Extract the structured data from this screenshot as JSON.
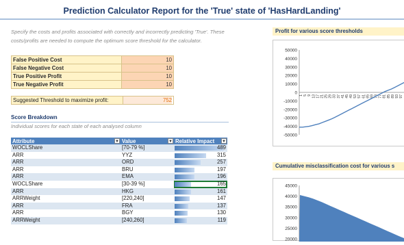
{
  "report": {
    "title": "Prediction Calculator Report for the 'True' state of 'HasHardLanding'",
    "note": "Specify the costs and profits associated with correctly and incorrectly predicting 'True'.  These costs/profits are needed to compute the optimum score threshold for the calculator."
  },
  "inputs": [
    {
      "label": "False Positive Cost",
      "value": "10"
    },
    {
      "label": "False Negative Cost",
      "value": "10"
    },
    {
      "label": "True Positive Profit",
      "value": "10"
    },
    {
      "label": "True Negative Profit",
      "value": "10"
    }
  ],
  "threshold": {
    "label": "Suggested Threshold to maximize profit:",
    "value": "752"
  },
  "score_breakdown": {
    "title": "Score Breakdown",
    "subtitle": "Individual scores for each state of each analysed column",
    "headers": {
      "attribute": "Attribute",
      "value": "Value",
      "impact": "Relative Impact"
    },
    "max_impact": 489,
    "rows": [
      {
        "attribute": "WOCLShare",
        "value": "[70-79 %]",
        "impact": 489
      },
      {
        "attribute": "ARR",
        "value": "YYZ",
        "impact": 315
      },
      {
        "attribute": "ARR",
        "value": "ORD",
        "impact": 257
      },
      {
        "attribute": "ARR",
        "value": "BRU",
        "impact": 197
      },
      {
        "attribute": "ARR",
        "value": "EMA",
        "impact": 196
      },
      {
        "attribute": "WOCLShare",
        "value": "[30-39 %]",
        "impact": 165
      },
      {
        "attribute": "ARR",
        "value": "HKG",
        "impact": 161
      },
      {
        "attribute": "ARRWeight",
        "value": "[220,240]",
        "impact": 147
      },
      {
        "attribute": "ARR",
        "value": "FRA",
        "impact": 137
      },
      {
        "attribute": "ARR",
        "value": "BGY",
        "impact": 130
      },
      {
        "attribute": "ARRWeight",
        "value": "[240,260]",
        "impact": 119
      }
    ]
  },
  "chart_data": [
    {
      "type": "line",
      "title": "Profit for various score thresholds",
      "ylim": [
        -50000,
        50000
      ],
      "yticks": [
        "50000",
        "40000",
        "30000",
        "20000",
        "10000",
        "0",
        "-10000",
        "-20000",
        "-30000",
        "-40000",
        "-50000"
      ],
      "xticks": [
        "1",
        "5",
        "9",
        "13",
        "17",
        "21",
        "25",
        "29",
        "33",
        "37",
        "41",
        "45",
        "49",
        "53",
        "57",
        "61",
        "65",
        "69",
        "73",
        "77",
        "81",
        "85",
        "89",
        "93",
        "97"
      ],
      "y": [
        -41000,
        -41000,
        -40500,
        -40000,
        -39000,
        -38000,
        -37000,
        -35500,
        -34000,
        -32500,
        -31000,
        -29000,
        -27000,
        -25000,
        -23000,
        -21000,
        -19000,
        -17000,
        -15000,
        -13000,
        -11000,
        -9000,
        -7000,
        -5000,
        -3000,
        -1000,
        1000,
        2500,
        4000,
        6000,
        8000,
        10000,
        12000
      ],
      "grid": false
    },
    {
      "type": "area",
      "title": "Cumulative misclassification cost for various s",
      "ylim": [
        20000,
        45000
      ],
      "yticks": [
        "45000",
        "40000",
        "35000",
        "30000",
        "25000",
        "20000"
      ],
      "y": [
        40500,
        40000,
        39500,
        38800,
        38000,
        37200,
        36300,
        35400,
        34500,
        33600,
        32700,
        31800,
        30900,
        30000,
        29100,
        28200,
        27300,
        26400,
        25500,
        24600,
        23700,
        22800,
        21900,
        21000,
        20200
      ],
      "grid": false
    }
  ]
}
